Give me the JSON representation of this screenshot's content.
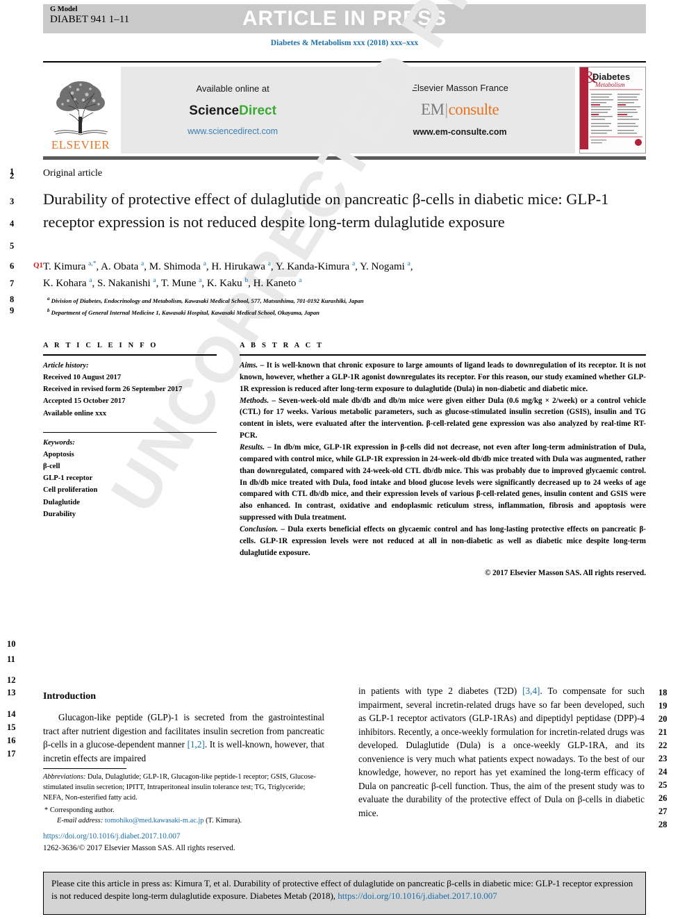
{
  "header": {
    "g_model": "G Model",
    "doc_id": "DIABET 941 1–11",
    "article_in_press": "ARTICLE IN PRESS",
    "journal_line": "Diabetes & Metabolism xxx (2018) xxx–xxx"
  },
  "masthead": {
    "elsevier_word": "ELSEVIER",
    "available_online": "Available online at",
    "sciencedirect_sci": "Science",
    "sciencedirect_dir": "Direct",
    "sciencedirect_url": "www.sciencedirect.com",
    "em_title": "Elsevier Masson France",
    "em_brand_em": "EM",
    "em_brand_consulte": "consulte",
    "em_url": "www.em-consulte.com",
    "cover_title": "Diabetes",
    "cover_subtitle": "Metabolism",
    "cover_amp": "&"
  },
  "article": {
    "type_label": "Original article",
    "title": "Durability of protective effect of dulaglutide on pancreatic β-cells in diabetic mice: GLP-1 receptor expression is not reduced despite long-term dulaglutide exposure",
    "query_tag": "Q1",
    "authors_line1": "T. Kimura <sup>a,*</sup>, A. Obata <sup>a</sup>, M. Shimoda <sup>a</sup>, H. Hirukawa <sup>a</sup>, Y. Kanda-Kimura <sup>a</sup>, Y. Nogami <sup>a</sup>,",
    "authors_line2": "K. Kohara <sup>a</sup>, S. Nakanishi <sup>a</sup>, T. Mune <sup>a</sup>, K. Kaku <sup>b</sup>, H. Kaneto <sup>a</sup>",
    "affiliation_a": "Division of Diabetes, Endocrinology and Metabolism, Kawasaki Medical School, 577, Matsushima, 701-0192 Kurashiki, Japan",
    "affiliation_b": "Department of General Internal Medicine 1, Kawasaki Hospital, Kawasaki Medical School, Okayama, Japan"
  },
  "article_info": {
    "heading": "A R T I C L E   I N F O",
    "history_label": "Article history:",
    "history": [
      "Received 10 August 2017",
      "Received in revised form 26 September 2017",
      "Accepted 15 October 2017",
      "Available online xxx"
    ],
    "keywords_label": "Keywords:",
    "keywords": [
      "Apoptosis",
      "β-cell",
      "GLP-1 receptor",
      "Cell proliferation",
      "Dulaglutide",
      "Durability"
    ]
  },
  "abstract": {
    "heading": "A B S T R A C T",
    "aims_label": "Aims.",
    "aims_text": " – It is well-known that chronic exposure to large amounts of ligand leads to downregulation of its receptor. It is not known, however, whether a GLP-1R agonist downregulates its receptor. For this reason, our study examined whether GLP-1R expression is reduced after long-term exposure to dulaglutide (Dula) in non-diabetic and diabetic mice.",
    "methods_label": "Methods.",
    "methods_text": " – Seven-week-old male db/db and db/m mice were given either Dula (0.6 mg/kg × 2/week) or a control vehicle (CTL) for 17 weeks. Various metabolic parameters, such as glucose-stimulated insulin secretion (GSIS), insulin and TG content in islets, were evaluated after the intervention. β-cell-related gene expression was also analyzed by real-time RT-PCR.",
    "results_label": "Results.",
    "results_text": " – In db/m mice, GLP-1R expression in β-cells did not decrease, not even after long-term administration of Dula, compared with control mice, while GLP-1R expression in 24-week-old db/db mice treated with Dula was augmented, rather than downregulated, compared with 24-week-old CTL db/db mice. This was probably due to improved glycaemic control. In db/db mice treated with Dula, food intake and blood glucose levels were significantly decreased up to 24 weeks of age compared with CTL db/db mice, and their expression levels of various β-cell-related genes, insulin content and GSIS were also enhanced. In contrast, oxidative and endoplasmic reticulum stress, inflammation, fibrosis and apoptosis were suppressed with Dula treatment.",
    "conclusion_label": "Conclusion.",
    "conclusion_text": " – Dula exerts beneficial effects on glycaemic control and has long-lasting protective effects on pancreatic β-cells. GLP-1R expression levels were not reduced at all in non-diabetic as well as diabetic mice despite long-term dulaglutide exposure.",
    "copyright": "© 2017 Elsevier Masson SAS. All rights reserved."
  },
  "introduction": {
    "heading": "Introduction",
    "left_para": "Glucagon-like peptide (GLP)-1 is secreted from the gastrointestinal tract after nutrient digestion and facilitates insulin secretion from pancreatic β-cells in a glucose-dependent manner [1,2]. It is well-known, however, that incretin effects are impaired",
    "left_ref": "[1,2]",
    "right_para": "in patients with type 2 diabetes (T2D) [3,4]. To compensate for such impairment, several incretin-related drugs have so far been developed, such as GLP-1 receptor activators (GLP-1RAs) and dipeptidyl peptidase (DPP)-4 inhibitors. Recently, a once-weekly formulation for incretin-related drugs was developed. Dulaglutide (Dula) is a once-weekly GLP-1RA, and its convenience is very much what patients expect nowadays. To the best of our knowledge, however, no report has yet examined the long-term efficacy of Dula on pancreatic β-cell function. Thus, the aim of the present study was to evaluate the durability of the protective effect of Dula on β-cells in diabetic mice.",
    "right_ref": "[3,4]"
  },
  "footnotes": {
    "abbrev_label": "Abbreviations:",
    "abbrev_text": " Dula, Dulaglutide; GLP-1R, Glucagon-like peptide-1 receptor; GSIS, Glucose-stimulated insulin secretion; IPITT, Intraperitoneal insulin tolerance test; TG, Triglyceride; NEFA, Non-esterified fatty acid.",
    "corresponding": "Corresponding author.",
    "email_label": "E-mail address:",
    "email": "tomohiko@med.kawasaki-m.ac.jp",
    "email_owner": " (T. Kimura).",
    "doi": "https://doi.org/10.1016/j.diabet.2017.10.007",
    "issn_line": "1262-3636/© 2017 Elsevier Masson SAS. All rights reserved."
  },
  "cite_box": {
    "text_before": "Please cite this article in press as: Kimura T, et al. Durability of protective effect of dulaglutide on pancreatic β-cells in diabetic mice: GLP-1 receptor expression is not reduced despite long-term dulaglutide exposure. Diabetes Metab (2018), ",
    "link": "https://doi.org/10.1016/j.diabet.2017.10.007"
  },
  "watermark": {
    "text": "UNCORRECTED PROOF"
  },
  "line_numbers": {
    "left": [
      "1",
      "2",
      "3",
      "4",
      "5",
      "6",
      "7",
      "8",
      "9",
      "10",
      "11",
      "12",
      "13",
      "14",
      "15",
      "16",
      "17"
    ],
    "right": [
      "18",
      "19",
      "20",
      "21",
      "22",
      "23",
      "24",
      "25",
      "26",
      "27",
      "28"
    ]
  },
  "colors": {
    "link": "#1a6ea8",
    "elsevier_orange": "#e87422",
    "sciencedirect_green": "#3aaa35",
    "query_red": "#d01b1b",
    "banner_grey": "#c9c9c9"
  }
}
